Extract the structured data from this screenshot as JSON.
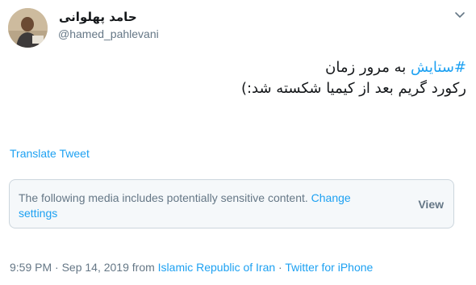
{
  "user": {
    "display_name": "حامد پهلوانی",
    "handle": "@hamed_pahlevani",
    "avatar_icon": "profile-photo"
  },
  "menu": {
    "icon": "chevron-down-icon"
  },
  "tweet": {
    "hashtag": "#ستایش",
    "line1_rest": " به مرور زمان",
    "line2": "رکورد گریم بعد از کیمیا شکسته شد:)"
  },
  "translate_label": "Translate Tweet",
  "sensitive": {
    "text": "The following media includes potentially sensitive content.",
    "change_label": "Change settings",
    "view_label": "View"
  },
  "meta": {
    "time": "9:59 PM · Sep 14, 2019 from ",
    "location": "Islamic Republic of Iran",
    "separator": " · ",
    "source": "Twitter for iPhone"
  },
  "colors": {
    "link": "#1da1f2",
    "secondary_text": "#657786",
    "box_background": "#f5f8fa",
    "box_border": "#ccd6dd"
  }
}
